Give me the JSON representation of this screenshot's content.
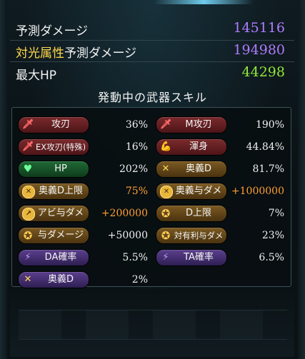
{
  "summary": {
    "predicted_damage": {
      "label": "予測ダメージ",
      "value": "145116"
    },
    "element_damage": {
      "label_element": "対光属性",
      "label_rest": "予測ダメージ",
      "value": "194980"
    },
    "max_hp": {
      "label": "最大HP",
      "value": "44298"
    }
  },
  "skills_title": "発動中の武器スキル",
  "skills": [
    {
      "name": "攻刃",
      "value": "36%",
      "icon": "sword-icon",
      "style": "red"
    },
    {
      "name": "M攻刃",
      "value": "190%",
      "icon": "sword-icon",
      "style": "red"
    },
    {
      "name": "EX攻刃(特殊)",
      "value": "16%",
      "icon": "sword-icon",
      "style": "red"
    },
    {
      "name": "渾身",
      "value": "44.84%",
      "icon": "flex-arm-icon",
      "style": "red"
    },
    {
      "name": "HP",
      "value": "202%",
      "icon": "heart-icon",
      "style": "green"
    },
    {
      "name": "奥義D",
      "value": "81.7%",
      "icon": "cross-swords-icon",
      "style": "gold"
    },
    {
      "name": "奥義D上限",
      "value": "75%",
      "icon": "coin-icon",
      "style": "gold",
      "highlight": true
    },
    {
      "name": "奥義与ダメ",
      "value": "+1000000",
      "icon": "coin-icon",
      "style": "gold",
      "highlight": true
    },
    {
      "name": "アビ与ダメ",
      "value": "+200000",
      "icon": "coin-icon",
      "style": "gold",
      "highlight": true
    },
    {
      "name": "D上限",
      "value": "7%",
      "icon": "gear-icon",
      "style": "gold"
    },
    {
      "name": "与ダメージ",
      "value": "+50000",
      "icon": "gear-icon",
      "style": "gold"
    },
    {
      "name": "対有利与ダメ",
      "value": "23%",
      "icon": "gear-icon",
      "style": "gold"
    },
    {
      "name": "DA確率",
      "value": "5.5%",
      "icon": "lightning-icon",
      "style": "purple"
    },
    {
      "name": "TA確率",
      "value": "6.5%",
      "icon": "lightning-icon",
      "style": "purple"
    },
    {
      "name": "奥義D",
      "value": "2%",
      "icon": "cross-swords-icon",
      "style": "purple"
    }
  ],
  "colors": {
    "label": "#f2f2f2",
    "element_highlight": "#ffd84a",
    "damage_value": "#b07bff",
    "hp_value": "#92e83a",
    "orange_value": "#ffa033"
  }
}
